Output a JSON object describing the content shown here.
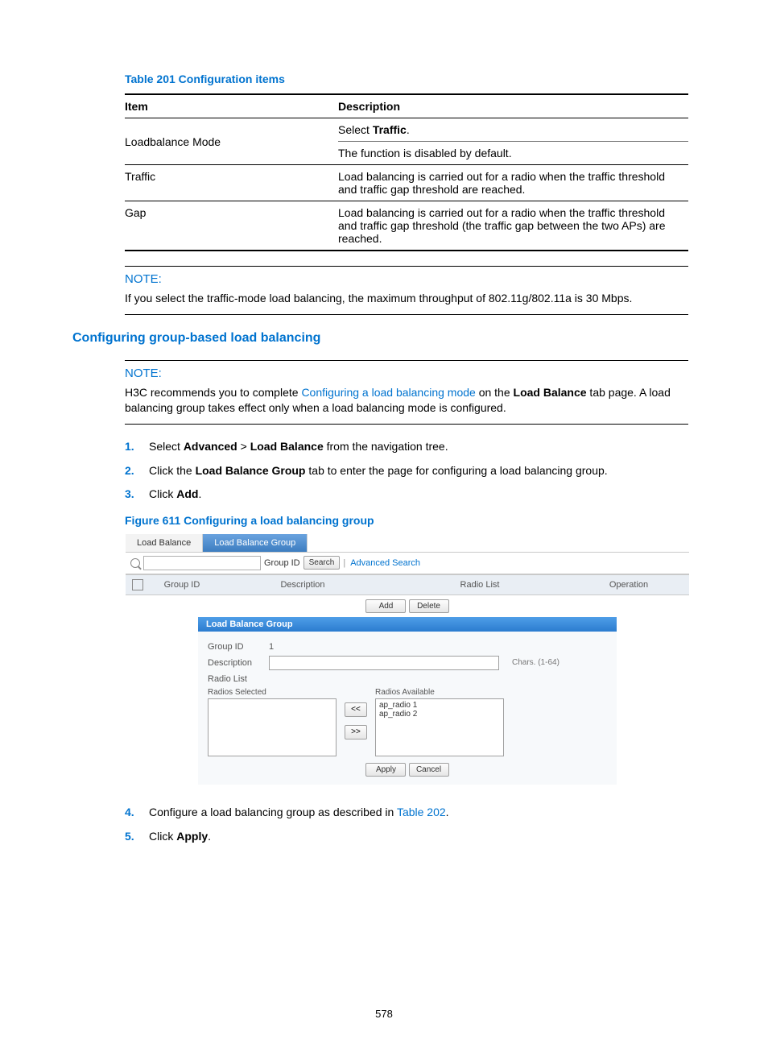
{
  "table201": {
    "caption": "Table 201 Configuration items",
    "headers": {
      "item": "Item",
      "desc": "Description"
    },
    "rows": {
      "loadbalance_mode": {
        "item": "Loadbalance Mode",
        "line1_pre": "Select ",
        "line1_b": "Traffic",
        "line1_post": ".",
        "line2": "The function is disabled by default."
      },
      "traffic": {
        "item": "Traffic",
        "desc": "Load balancing is carried out for a radio when the traffic threshold and traffic gap threshold are reached."
      },
      "gap": {
        "item": "Gap",
        "desc": "Load balancing is carried out for a radio when the traffic threshold and traffic gap threshold (the traffic gap between the two APs) are reached."
      }
    }
  },
  "note1": {
    "label": "NOTE:",
    "text": "If you select the traffic-mode load balancing, the maximum throughput of 802.11g/802.11a is 30 Mbps."
  },
  "section_heading": "Configuring group-based load balancing",
  "note2": {
    "label": "NOTE:",
    "text_pre": "H3C recommends you to complete ",
    "link": "Configuring a load balancing mode",
    "text_mid": " on the ",
    "bold": "Load Balance",
    "text_post": " tab page. A load balancing group takes effect only when a load balancing mode is configured."
  },
  "steps_a": [
    {
      "pre": "Select ",
      "b1": "Advanced",
      "gt": " > ",
      "b2": "Load Balance",
      "post": " from the navigation tree."
    },
    {
      "pre": "Click the ",
      "b1": "Load Balance Group",
      "post": " tab to enter the page for configuring a load balancing group."
    },
    {
      "pre": "Click ",
      "b1": "Add",
      "post": "."
    }
  ],
  "figure_caption": "Figure 611 Configuring a load balancing group",
  "ui": {
    "tabs": {
      "load_balance": "Load Balance",
      "load_balance_group": "Load Balance Group"
    },
    "search": {
      "select_label": "Group ID",
      "btn": "Search",
      "adv": "Advanced Search"
    },
    "table_headers": {
      "group_id": "Group ID",
      "description": "Description",
      "radio_list": "Radio List",
      "operation": "Operation"
    },
    "buttons": {
      "add": "Add",
      "delete": "Delete",
      "apply": "Apply",
      "cancel": "Cancel",
      "move_left": "<<",
      "move_right": ">>"
    },
    "form": {
      "title": "Load Balance Group",
      "group_id_label": "Group ID",
      "group_id_value": "1",
      "description_label": "Description",
      "chars_hint": "Chars. (1-64)",
      "radio_list_label": "Radio List",
      "radios_selected_label": "Radios Selected",
      "radios_available_label": "Radios Available",
      "available": [
        "ap_radio 1",
        "ap_radio 2"
      ]
    }
  },
  "steps_b": [
    {
      "pre": "Configure a load balancing group as described in ",
      "link": "Table 202",
      "post": "."
    },
    {
      "pre": "Click ",
      "b1": "Apply",
      "post": "."
    }
  ],
  "page_number": "578"
}
